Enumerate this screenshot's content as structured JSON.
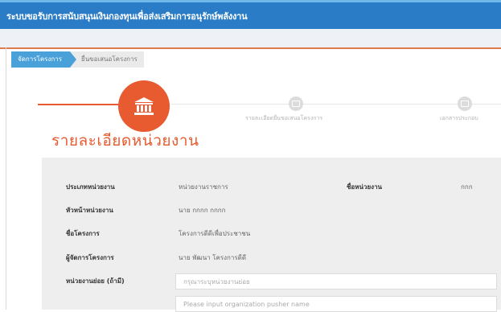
{
  "app": {
    "title": "ระบบขอรับการสนับสนุนเงินกองทุนเพื่อส่งเสริมการอนุรักษ์พลังงาน"
  },
  "breadcrumb": {
    "items": [
      "จัดการโครงการ",
      "ยื่นขอเสนอโครงการ"
    ]
  },
  "steps": [
    {
      "label": ""
    },
    {
      "label": "รายละเอียดยื่นขอเสนอโครงการ"
    },
    {
      "label": "เอกสารประกอบ"
    }
  ],
  "section": {
    "title": "รายละเอียดหน่วยงาน"
  },
  "form": {
    "org_type_label": "ประเภทหน่วยงาน",
    "org_type_value": "หน่วยงานราชการ",
    "org_name_label": "ชื่อหน่วยงาน",
    "org_name_value": "กกก",
    "head_label": "หัวหน้าหน่วยงาน",
    "head_value": "นาย กกกก กกกก",
    "project_label": "ชื่อโครงการ",
    "project_value": "โครงการดีดีเพื่อประชาชน",
    "manager_label": "ผู้จัดการโครงการ",
    "manager_value": "นาย พัฒนา โครงการดีดี",
    "suborg_label": "หน่วยงานย่อย (ถ้ามี)",
    "suborg_placeholder": "กรุณาระบุหน่วยงานย่อย",
    "pusher_placeholder": "Please input organization pusher name"
  },
  "colors": {
    "header": "#2a7cc7",
    "accent": "#e85a2f",
    "crumb": "#4aa0d8"
  },
  "icons": {
    "step1": "bank-icon",
    "step2": "document-icon",
    "step3": "document-icon"
  }
}
